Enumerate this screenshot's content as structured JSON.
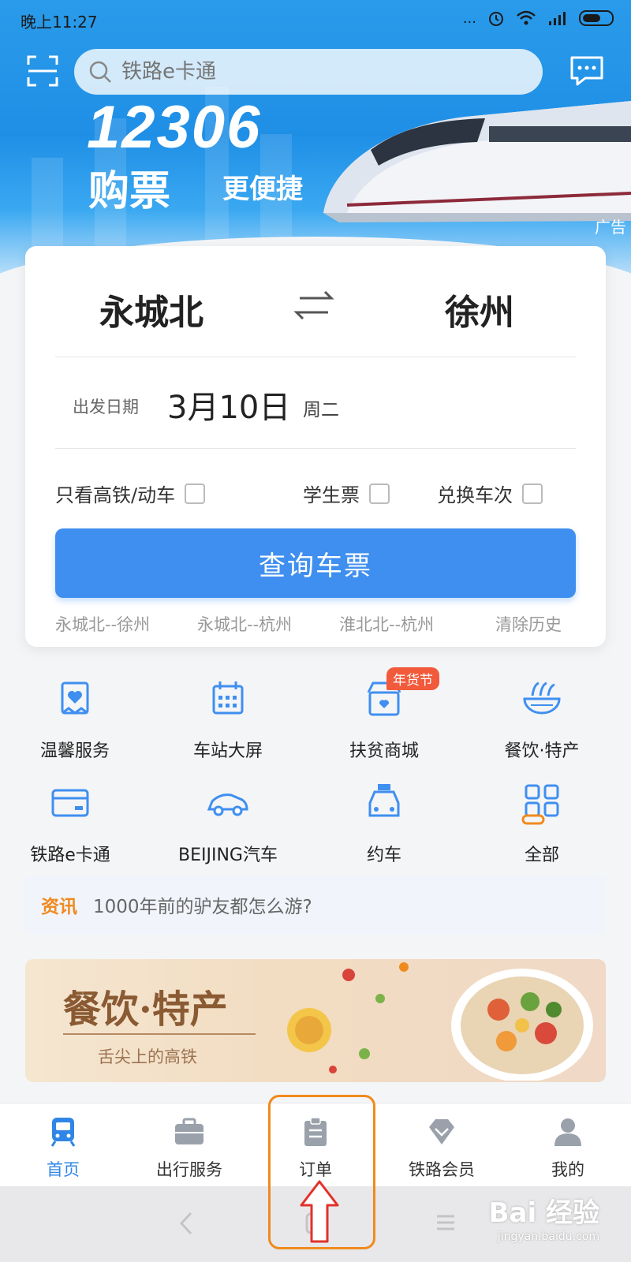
{
  "status_bar": {
    "time": "晚上11:27",
    "signal_text": "...",
    "alarm_icon": "alarm-icon",
    "wifi_icon": "wifi-icon"
  },
  "header": {
    "search_placeholder": "铁路e卡通",
    "banner_number": "12306",
    "banner_slogan_main": "购票",
    "banner_slogan_sub": "更便捷",
    "ad_label": "广告"
  },
  "ticket": {
    "from_station": "永城北",
    "to_station": "徐州",
    "date_label": "出发日期",
    "date_value": "3月10日",
    "weekday": "周二",
    "options": [
      "只看高铁/动车",
      "学生票",
      "兑换车次"
    ],
    "query_button": "查询车票",
    "history": [
      "永城北--徐州",
      "永城北--杭州",
      "淮北北--杭州"
    ],
    "clear_history": "清除历史"
  },
  "services": [
    {
      "label": "温馨服务",
      "icon": "care-service-icon"
    },
    {
      "label": "车站大屏",
      "icon": "station-screen-icon"
    },
    {
      "label": "扶贫商城",
      "icon": "shop-icon"
    },
    {
      "label": "餐饮·特产",
      "icon": "food-bowl-icon"
    },
    {
      "label": "铁路e卡通",
      "icon": "card-icon"
    },
    {
      "label": "BEIJING汽车",
      "icon": "car-icon"
    },
    {
      "label": "约车",
      "icon": "taxi-icon"
    },
    {
      "label": "全部",
      "icon": "grid-icon"
    }
  ],
  "badge_text": "年货节",
  "news": {
    "tag": "资讯",
    "text": "1000年前的驴友都怎么游?"
  },
  "promo": {
    "title": "餐饮·特产",
    "subtitle": "舌尖上的高铁"
  },
  "tabs": [
    {
      "label": "首页",
      "icon": "train-icon",
      "active": true
    },
    {
      "label": "出行服务",
      "icon": "briefcase-icon",
      "active": false
    },
    {
      "label": "订单",
      "icon": "clipboard-icon",
      "active": false
    },
    {
      "label": "铁路会员",
      "icon": "diamond-icon",
      "active": false
    },
    {
      "label": "我的",
      "icon": "person-icon",
      "active": false
    }
  ],
  "watermark": {
    "brand": "Bai 经验",
    "url": "jingyan.baidu.com"
  },
  "colors": {
    "primary": "#3f8ff0",
    "accent": "#f08a1e",
    "badge": "#f25a3c"
  }
}
